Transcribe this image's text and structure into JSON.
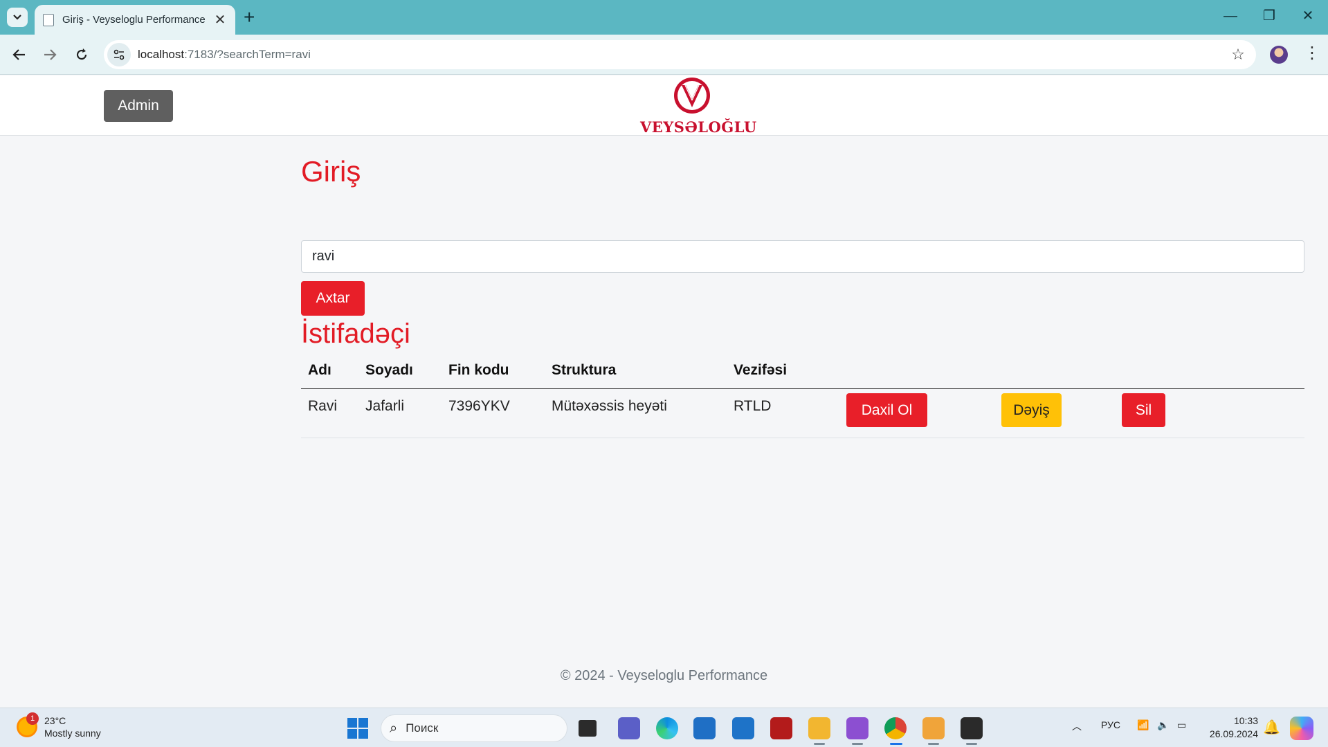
{
  "browser": {
    "tab_title": "Giriş - Veyseloglu Performance",
    "url_host": "localhost",
    "url_rest": ":7183/?searchTerm=ravi"
  },
  "header": {
    "admin_label": "Admin",
    "logo_text": "VEYSƏLOĞLU",
    "logo_mark_letter": "V"
  },
  "main": {
    "title": "Giriş",
    "search_value": "ravi",
    "search_button": "Axtar",
    "users_title": "İstifadəçi",
    "columns": [
      "Adı",
      "Soyadı",
      "Fin kodu",
      "Struktura",
      "Vezifəsi"
    ],
    "rows": [
      {
        "first_name": "Ravi",
        "last_name": "Jafarli",
        "fin": "7396YKV",
        "structure": "Mütəxəssis heyəti",
        "position": "RTLD",
        "login_label": "Daxil Ol",
        "edit_label": "Dəyiş",
        "delete_label": "Sil"
      }
    ]
  },
  "footer": {
    "text": "© 2024 - Veyseloglu Performance"
  },
  "taskbar": {
    "weather_temp": "23°C",
    "weather_desc": "Mostly sunny",
    "weather_badge": "1",
    "search_placeholder": "Поиск",
    "lang": "РУС",
    "time": "10:33",
    "date": "26.09.2024"
  },
  "colors": {
    "accent": "#e21b25",
    "warning": "#ffc107",
    "admin": "#5f5f5f",
    "chrome": "#5bb7c2"
  }
}
